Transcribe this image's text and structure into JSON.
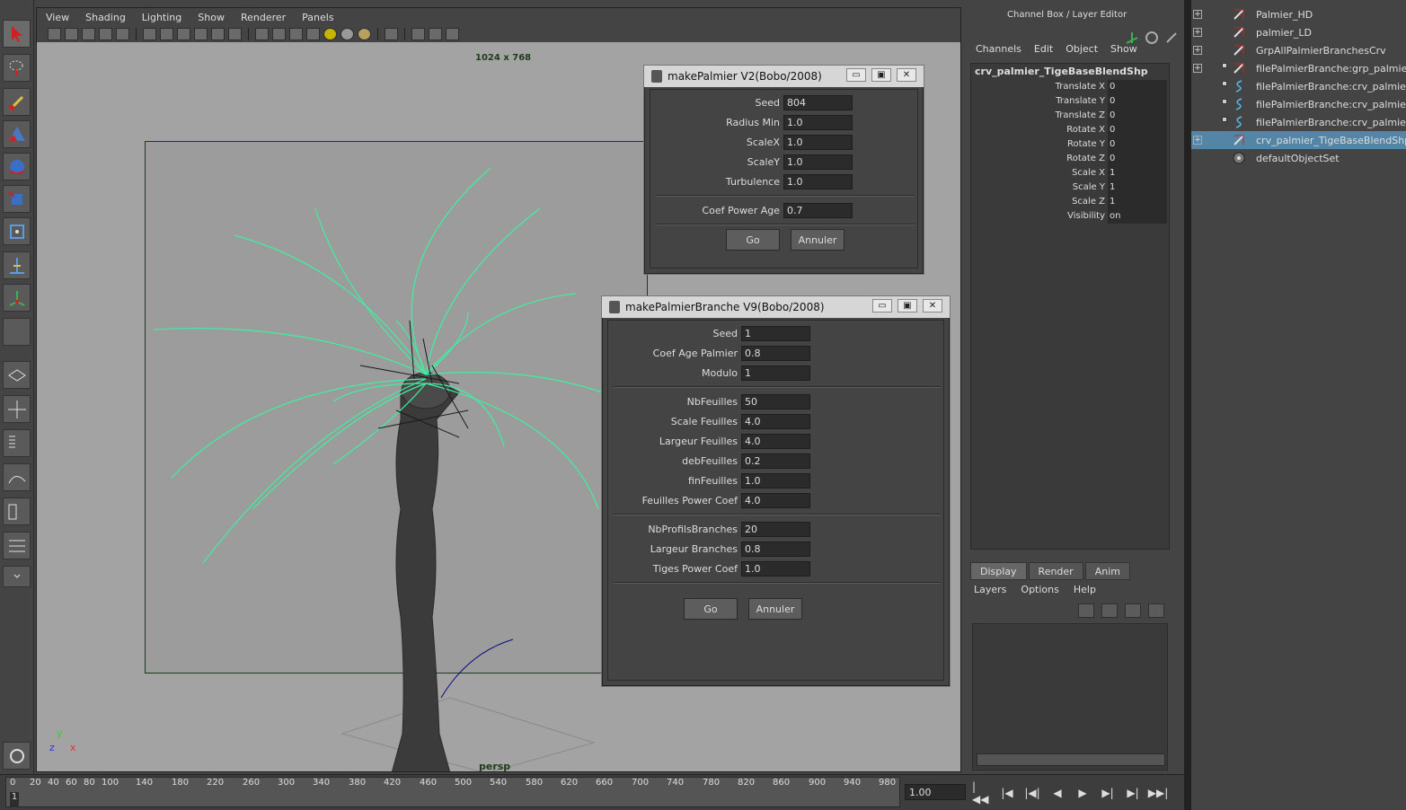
{
  "viewport": {
    "menus": [
      "View",
      "Shading",
      "Lighting",
      "Show",
      "Renderer",
      "Panels"
    ],
    "resolution_label": "1024 x 768",
    "camera_label": "persp"
  },
  "dialog1": {
    "title": "makePalmier V2(Bobo/2008)",
    "btn_min": "▭",
    "btn_max": "▣",
    "btn_close": "✕",
    "fields": [
      {
        "label": "Seed",
        "value": "804"
      },
      {
        "label": "Radius Min",
        "value": "1.0"
      },
      {
        "label": "ScaleX",
        "value": "1.0"
      },
      {
        "label": "ScaleY",
        "value": "1.0"
      },
      {
        "label": "Turbulence",
        "value": "1.0"
      },
      {
        "label": "Coef Power Age",
        "value": "0.7"
      }
    ],
    "go_label": "Go",
    "cancel_label": "Annuler"
  },
  "dialog2": {
    "title": "makePalmierBranche V9(Bobo/2008)",
    "btn_min": "▭",
    "btn_max": "▣",
    "btn_close": "✕",
    "fields": [
      {
        "label": "Seed",
        "value": "1"
      },
      {
        "label": "Coef Age Palmier",
        "value": "0.8"
      },
      {
        "label": "Modulo",
        "value": "1"
      },
      {
        "label": "NbFeuilles",
        "value": "50"
      },
      {
        "label": "Scale Feuilles",
        "value": "4.0"
      },
      {
        "label": "Largeur Feuilles",
        "value": "4.0"
      },
      {
        "label": "debFeuilles",
        "value": "0.2"
      },
      {
        "label": "finFeuilles",
        "value": "1.0"
      },
      {
        "label": "Feuilles Power Coef",
        "value": "4.0"
      },
      {
        "label": "NbProfilsBranches",
        "value": "20"
      },
      {
        "label": "Largeur Branches",
        "value": "0.8"
      },
      {
        "label": "Tiges Power Coef",
        "value": "1.0"
      }
    ],
    "go_label": "Go",
    "cancel_label": "Annuler"
  },
  "channel_box": {
    "title": "Channel Box / Layer Editor",
    "menus": [
      "Channels",
      "Edit",
      "Object",
      "Show"
    ],
    "object_name": "crv_palmier_TigeBaseBlendShp",
    "attributes": [
      {
        "name": "Translate X",
        "value": "0"
      },
      {
        "name": "Translate Y",
        "value": "0"
      },
      {
        "name": "Translate Z",
        "value": "0"
      },
      {
        "name": "Rotate X",
        "value": "0"
      },
      {
        "name": "Rotate Y",
        "value": "0"
      },
      {
        "name": "Rotate Z",
        "value": "0"
      },
      {
        "name": "Scale X",
        "value": "1"
      },
      {
        "name": "Scale Y",
        "value": "1"
      },
      {
        "name": "Scale Z",
        "value": "1"
      },
      {
        "name": "Visibility",
        "value": "on"
      }
    ],
    "layer_tabs": [
      "Display",
      "Render",
      "Anim"
    ],
    "layer_menus": [
      "Layers",
      "Options",
      "Help"
    ]
  },
  "outliner": {
    "items": [
      {
        "label": "Palmier_HD",
        "expand": "+",
        "kind": "transform",
        "sub": false,
        "selected": false
      },
      {
        "label": "palmier_LD",
        "expand": "+",
        "kind": "transform",
        "sub": false,
        "selected": false
      },
      {
        "label": "GrpAllPalmierBranchesCrv",
        "expand": "+",
        "kind": "transform",
        "sub": false,
        "selected": false
      },
      {
        "label": "filePalmierBranche:grp_palmier_fe",
        "expand": "+",
        "kind": "transform",
        "sub": true,
        "selected": false
      },
      {
        "label": "filePalmierBranche:crv_palmier_br",
        "expand": "",
        "kind": "curve",
        "sub": true,
        "selected": false
      },
      {
        "label": "filePalmierBranche:crv_palmier_fe",
        "expand": "",
        "kind": "curve",
        "sub": true,
        "selected": false
      },
      {
        "label": "filePalmierBranche:crv_palmier_Tig",
        "expand": "",
        "kind": "curve",
        "sub": true,
        "selected": false
      },
      {
        "label": "crv_palmier_TigeBaseBlendShp",
        "expand": "+",
        "kind": "transform",
        "sub": false,
        "selected": true
      },
      {
        "label": "defaultObjectSet",
        "expand": "",
        "kind": "set",
        "sub": false,
        "selected": false
      }
    ]
  },
  "timeline": {
    "ticks": [
      "0",
      "20",
      "40",
      "60",
      "80",
      "100",
      "140",
      "180",
      "220",
      "260",
      "300",
      "340",
      "380",
      "420",
      "460",
      "500",
      "540",
      "580",
      "620",
      "660",
      "700",
      "740",
      "780",
      "820",
      "860",
      "900",
      "940",
      "980"
    ],
    "current_frame": "1",
    "frame_field": "1.00",
    "playback_buttons": [
      "|◀◀",
      "|◀",
      "|◀|",
      "◀",
      "▶",
      "▶|",
      "▶|",
      "▶▶|"
    ]
  },
  "colors": {
    "accent_selection": "#5285a6",
    "curve_green": "#3ef0a0",
    "viewport_bg": "#a3a3a3"
  }
}
